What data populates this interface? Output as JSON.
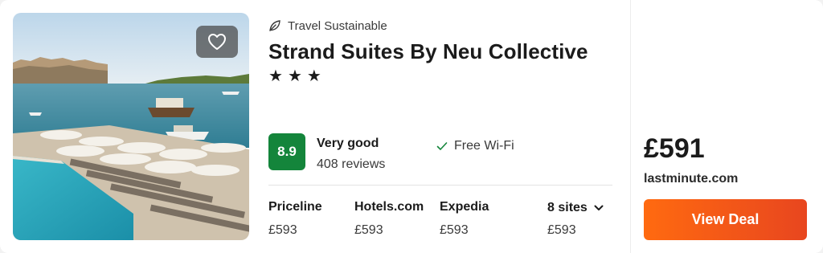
{
  "hotel": {
    "sustainability_label": "Travel Sustainable",
    "name": "Strand Suites By Neu Collective",
    "stars": [
      "★",
      "★",
      "★"
    ],
    "rating": {
      "score": "8.9",
      "label": "Very good",
      "reviews": "408 reviews",
      "badge_color": "#14853b"
    },
    "amenity": "Free Wi-Fi"
  },
  "prices": [
    {
      "site": "Priceline",
      "price": "£593"
    },
    {
      "site": "Hotels.com",
      "price": "£593"
    },
    {
      "site": "Expedia",
      "price": "£593"
    }
  ],
  "more_sites": {
    "label": "8 sites",
    "price": "£593"
  },
  "deal": {
    "price": "£591",
    "site": "lastminute.com",
    "button_label": "View Deal",
    "button_color": "#ff5b1a"
  },
  "icons": {
    "favorite": "heart-icon",
    "sustainability": "leaf-icon",
    "amenity": "check-icon",
    "expand": "chevron-down-icon"
  }
}
